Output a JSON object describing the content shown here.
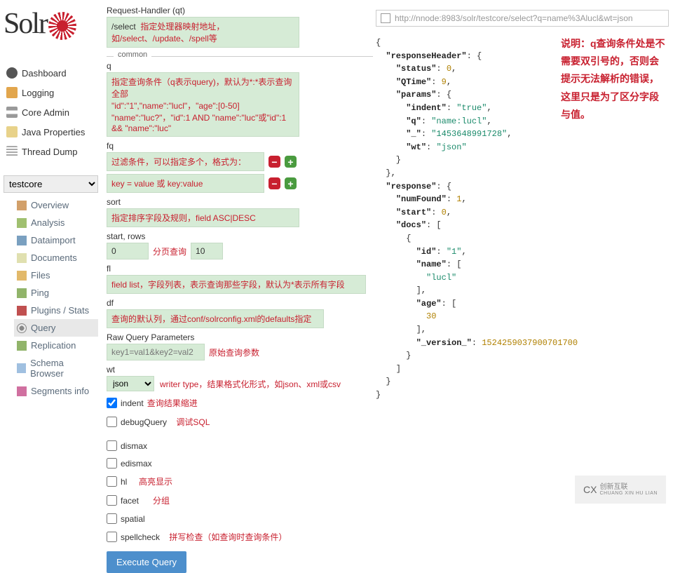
{
  "logo_text": "Solr",
  "nav": {
    "dashboard": "Dashboard",
    "logging": "Logging",
    "coreadmin": "Core Admin",
    "javaprops": "Java Properties",
    "threaddump": "Thread Dump"
  },
  "core_select": "testcore",
  "subnav": {
    "overview": "Overview",
    "analysis": "Analysis",
    "dataimport": "Dataimport",
    "documents": "Documents",
    "files": "Files",
    "ping": "Ping",
    "plugins": "Plugins / Stats",
    "query": "Query",
    "replication": "Replication",
    "schema": "Schema Browser",
    "segments": "Segments info"
  },
  "form": {
    "rh_label": "Request-Handler (qt)",
    "rh_value": "/select",
    "rh_annot": "指定处理器映射地址，如/select、/update、/spell等",
    "common": "common",
    "q_label": "q",
    "q_line1": "指定查询条件（q表示query)，默认为*:*表示查询全部",
    "q_line2": "\"id\":\"1\",\"name\":\"lucl\"，\"age\":[0-50]",
    "q_line3": "\"name\":\"luc?\"，\"id\":1 AND \"name\":\"luc\"或\"id\":1 && \"name\":\"luc\"",
    "fq_label": "fq",
    "fq_line1": "过滤条件，可以指定多个，格式为：",
    "fq_line2": "key = value 或 key:value",
    "sort_label": "sort",
    "sort_value": "指定排序字段及规则，field ASC|DESC",
    "startrows_label": "start, rows",
    "start_value": "0",
    "rows_value": "10",
    "start_annot": "分页查询",
    "fl_label": "fl",
    "fl_value": "field list，字段列表，表示查询那些字段，默认为*表示所有字段",
    "df_label": "df",
    "df_value": "查询的默认列，通过conf/solrconfig.xml的defaults指定",
    "raw_label": "Raw Query Parameters",
    "raw_value": "key1=val1&key2=val2",
    "raw_annot": "原始查询参数",
    "wt_label": "wt",
    "wt_value": "json",
    "wt_annot": "writer type，结果格式化形式，如json、xml或csv",
    "indent": "indent",
    "indent_annot": "查询结果缩进",
    "debugQuery": "debugQuery",
    "debug_annot": "调试SQL",
    "dismax": "dismax",
    "edismax": "edismax",
    "hl": "hl",
    "hl_annot": "高亮显示",
    "facet": "facet",
    "facet_annot": "分组",
    "spatial": "spatial",
    "spellcheck": "spellcheck",
    "spell_annot": "拼写检查（如查询时查询条件）",
    "exec": "Execute Query"
  },
  "url": "http://nnode:8983/solr/testcore/select?q=name%3Alucl&wt=json",
  "explain": "说明：q查询条件处是不需要双引号的，否则会提示无法解析的错误，这里只是为了区分字段与值。",
  "footer": {
    "cx": "CX",
    "cn": "创新互联",
    "py": "CHUANG XIN HU LIAN"
  },
  "json": {
    "status": 0,
    "QTime": 9,
    "indent": "true",
    "q": "name:lucl",
    "underscore": "1453648991728",
    "wt": "json",
    "numFound": 1,
    "start": 0,
    "id": "1",
    "name": "",
    "name_val": "lucl",
    "age": "",
    "age_val": 30,
    "version": 1524259037900701700
  }
}
